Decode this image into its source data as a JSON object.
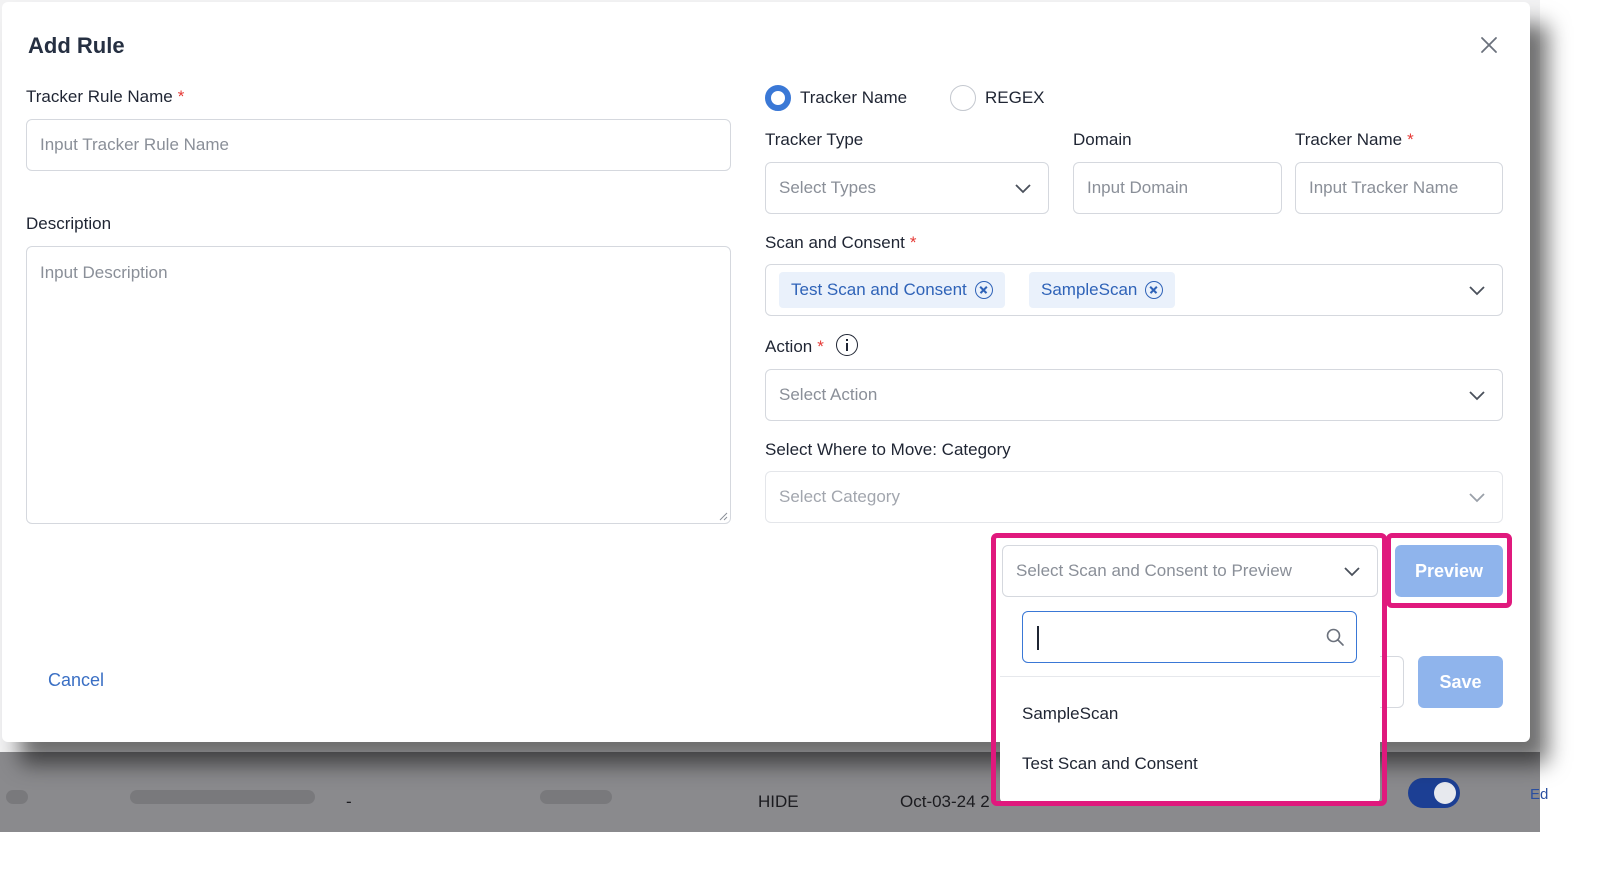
{
  "background_row": {
    "dash": "-",
    "action": "HIDE",
    "date": "Oct-03-24 2",
    "edit_fragment": "Ed"
  },
  "modal": {
    "title": "Add Rule",
    "left": {
      "rule_name_label": "Tracker Rule Name",
      "rule_name_placeholder": "Input Tracker Rule Name",
      "description_label": "Description",
      "description_placeholder": "Input Description"
    },
    "match_mode": {
      "options": [
        "Tracker Name",
        "REGEX"
      ],
      "selected": "Tracker Name"
    },
    "tracker_type": {
      "label": "Tracker Type",
      "placeholder": "Select Types"
    },
    "domain": {
      "label": "Domain",
      "placeholder": "Input Domain"
    },
    "tracker_name": {
      "label": "Tracker Name",
      "placeholder": "Input Tracker Name"
    },
    "scan_consent": {
      "label": "Scan and Consent",
      "tags": [
        "Test Scan and Consent",
        "SampleScan"
      ]
    },
    "action": {
      "label": "Action",
      "placeholder": "Select Action"
    },
    "category": {
      "label": "Select Where to Move: Category",
      "placeholder": "Select Category"
    },
    "preview_select": {
      "placeholder": "Select Scan and Consent to Preview",
      "search_value": ""
    },
    "preview_options": [
      "SampleScan",
      "Test Scan and Consent"
    ],
    "buttons": {
      "preview": "Preview",
      "cancel": "Cancel",
      "save": "Save"
    },
    "required_mark": "*"
  },
  "colors": {
    "primary": "#3a78d6",
    "tag_bg": "#eaf1fb",
    "button_disabled": "#8fb4ec",
    "highlight": "#e0197d",
    "required": "#e53935"
  },
  "icons": [
    "close-icon",
    "chevron-down-icon",
    "info-icon",
    "search-icon",
    "remove-tag-icon"
  ]
}
